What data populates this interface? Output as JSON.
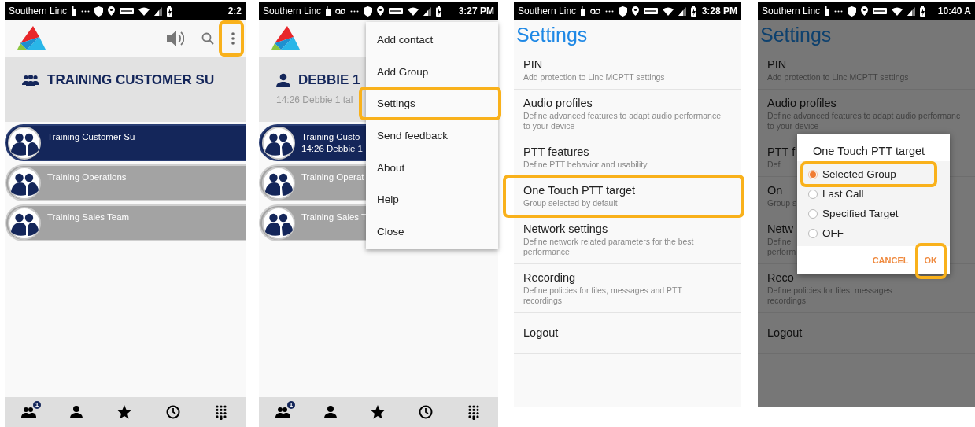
{
  "screens": [
    {
      "kind": "groups",
      "status_bar": {
        "carrier": "Southern Linc",
        "voicemail": false,
        "time": "2:2"
      },
      "toolbar": {
        "actions": true,
        "more_highlighted": true
      },
      "header": {
        "kind": "group",
        "title": "TRAINING CUSTOMER SU"
      },
      "groups": [
        {
          "name": "Training Customer Su",
          "selected": true
        },
        {
          "name": "Training Operations",
          "selected": false
        },
        {
          "name": "Training Sales Team",
          "selected": false
        }
      ],
      "bottom_nav": [
        {
          "kind": "groups",
          "badge": "1"
        },
        {
          "kind": "contact"
        },
        {
          "kind": "favorites"
        },
        {
          "kind": "recent"
        },
        {
          "kind": "keypad"
        }
      ]
    },
    {
      "kind": "groups",
      "status_bar": {
        "carrier": "Southern Linc",
        "voicemail": true,
        "time": "3:27 PM"
      },
      "toolbar": {
        "actions": false
      },
      "header": {
        "kind": "contact",
        "title": "DEBBIE 1",
        "subtitle": "14:26 Debbie 1 tal"
      },
      "groups": [
        {
          "name": "Training Custo",
          "line_2": "14:26 Debbie 1",
          "selected": true
        },
        {
          "name": "Training Operat",
          "selected": false
        },
        {
          "name": "Training Sales T",
          "selected": false
        }
      ],
      "menu": [
        {
          "label": "Add contact",
          "highlighted": false
        },
        {
          "label": "Add Group",
          "highlighted": false
        },
        {
          "label": "Settings",
          "highlighted": true
        },
        {
          "label": "Send feedback",
          "highlighted": false
        },
        {
          "label": "About",
          "highlighted": false
        },
        {
          "label": "Help",
          "highlighted": false
        },
        {
          "label": "Close",
          "highlighted": false
        }
      ],
      "bottom_nav": [
        {
          "kind": "groups",
          "badge": "1"
        },
        {
          "kind": "contact"
        },
        {
          "kind": "favorites"
        },
        {
          "kind": "recent"
        },
        {
          "kind": "keypad"
        }
      ]
    },
    {
      "kind": "settings",
      "status_bar": {
        "carrier": "Southern Linc",
        "voicemail": true,
        "time": "3:28 PM"
      },
      "title": "Settings",
      "items": [
        {
          "title": "PIN",
          "description_lines": [
            "Add protection to Linc MCPTT settings"
          ],
          "highlighted": false
        },
        {
          "title": "Audio profiles",
          "description_lines": [
            "Define advanced features to adapt audio performance",
            "to your device"
          ],
          "highlighted": false
        },
        {
          "title": "PTT features",
          "description_lines": [
            "Define PTT behavior and usability"
          ],
          "highlighted": false
        },
        {
          "title": "One Touch PTT target",
          "description_lines": [
            "Group selected by default"
          ],
          "highlighted": true
        },
        {
          "title": "Network settings",
          "description_lines": [
            "Define network related parameters for the best",
            "performance"
          ],
          "highlighted": false
        },
        {
          "title": "Recording",
          "description_lines": [
            "Define policies for files, messages and PTT",
            "recordings"
          ],
          "highlighted": false
        },
        {
          "title": "Logout",
          "highlighted": false
        }
      ]
    },
    {
      "kind": "settings",
      "status_bar": {
        "carrier": "Southern Linc",
        "voicemail": false,
        "time": "10:40 A"
      },
      "title": "Settings",
      "items": [
        {
          "title": "PIN",
          "description_lines": [
            "Add protection to Linc MCPTT settings"
          ],
          "highlighted": false
        },
        {
          "title": "Audio profiles",
          "description_lines": [
            "Define advanced features to adapt audio performanc",
            "to your device"
          ],
          "highlighted": false
        },
        {
          "title": "PTT f",
          "description_lines": [
            "Defi"
          ],
          "highlighted": false
        },
        {
          "title": "On",
          "description_lines": [
            "Group s"
          ],
          "highlighted": false
        },
        {
          "title": "Netw",
          "description_lines": [
            "Define",
            "perform"
          ],
          "highlighted": false
        },
        {
          "title": "Reco",
          "description_lines": [
            "Define policies for files, messages",
            "recordings"
          ],
          "highlighted": false
        },
        {
          "title": "Logout",
          "highlighted": false
        }
      ],
      "dialog": {
        "title": "One Touch PTT target",
        "options": [
          {
            "label": "Selected Group",
            "selected": true,
            "highlighted": true
          },
          {
            "label": "Last Call",
            "selected": false,
            "highlighted": false
          },
          {
            "label": "Specified Target",
            "selected": false,
            "highlighted": false
          },
          {
            "label": "OFF",
            "selected": false,
            "highlighted": false
          }
        ],
        "buttons": [
          {
            "label": "CANCEL",
            "highlighted": false
          },
          {
            "label": "OK",
            "highlighted": true
          }
        ]
      }
    }
  ]
}
